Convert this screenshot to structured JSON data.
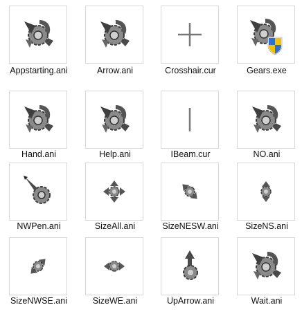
{
  "files": [
    {
      "name": "Appstarting.ani",
      "icon": "gears-cursor-icon"
    },
    {
      "name": "Arrow.ani",
      "icon": "gears-cursor-icon"
    },
    {
      "name": "Crosshair.cur",
      "icon": "crosshair-icon"
    },
    {
      "name": "Gears.exe",
      "icon": "gears-shield-exe-icon"
    },
    {
      "name": "Hand.ani",
      "icon": "gears-cursor-icon"
    },
    {
      "name": "Help.ani",
      "icon": "gears-cursor-icon"
    },
    {
      "name": "IBeam.cur",
      "icon": "ibeam-icon"
    },
    {
      "name": "NO.ani",
      "icon": "gears-cursor-icon"
    },
    {
      "name": "NWPen.ani",
      "icon": "gear-pen-icon"
    },
    {
      "name": "SizeAll.ani",
      "icon": "size-all-icon"
    },
    {
      "name": "SizeNESW.ani",
      "icon": "size-nesw-icon"
    },
    {
      "name": "SizeNS.ani",
      "icon": "size-ns-icon"
    },
    {
      "name": "SizeNWSE.ani",
      "icon": "size-nwse-icon"
    },
    {
      "name": "SizeWE.ani",
      "icon": "size-we-icon"
    },
    {
      "name": "UpArrow.ani",
      "icon": "up-arrow-gear-icon"
    },
    {
      "name": "Wait.ani",
      "icon": "gears-cursor-icon"
    }
  ],
  "colors": {
    "tile_border": "#d7d7d7",
    "icon_dark": "#3a3a3a",
    "icon_mid": "#7a7a7a",
    "icon_light": "#b5b5b5",
    "shield_blue": "#2e6fcf",
    "shield_yellow": "#f2c200"
  }
}
